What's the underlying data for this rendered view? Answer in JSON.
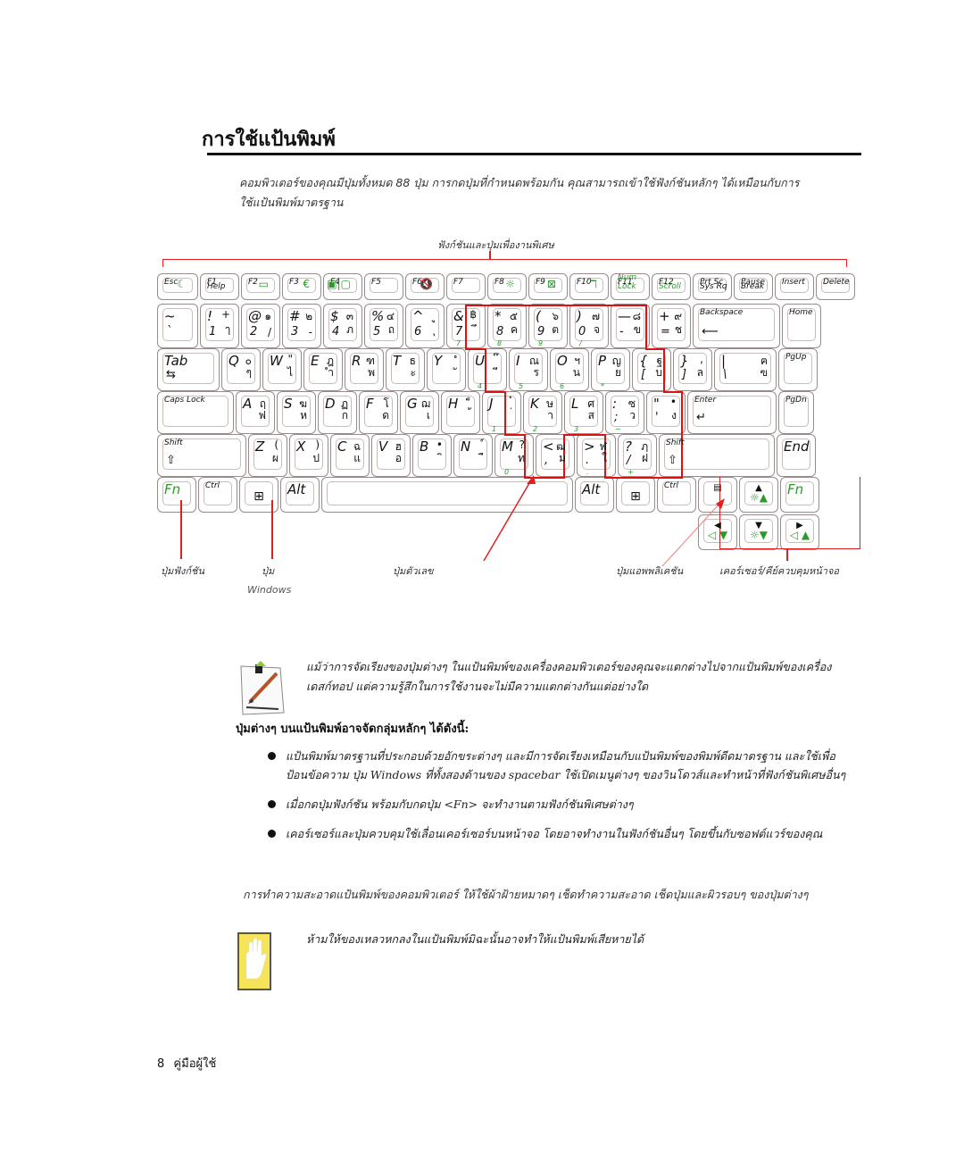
{
  "page": {
    "title": "การใช้แป้นพิมพ์",
    "intro": "คอมพิวเตอร์ของคุณมีปุ่มทั้งหมด 88 ปุ่ม การกดปุ่มที่กำหนดพร้อมกัน คุณสามารถเข้าใช้ฟังก์ชันหลักๆ ได้เหมือนกับการใช้แป้นพิมพ์มาตรฐาน"
  },
  "diagram": {
    "top_caption": "ฟังก์ชันและปุ่มเพื่องานพิเศษ",
    "callouts": {
      "fn_key": "ปุ่มฟังก์ชัน",
      "windows_key_line1": "ปุ่ม",
      "windows_key_line2": "Windows",
      "numeric_keys": "ปุ่มตัวเลข",
      "application_key": "ปุ่มแอพพลิเคชัน",
      "cursor_keys": "เคอร์เซอร์/คีย์ควบคุมหน้าจอ"
    },
    "function_row": [
      {
        "label": "Esc",
        "icon": "moon-icon",
        "glyph": "☾"
      },
      {
        "label": "F1",
        "sub": "Help"
      },
      {
        "label": "F2",
        "icon": "battery-icon",
        "glyph": "▭"
      },
      {
        "label": "F3",
        "icon": "euro-icon",
        "glyph": "€"
      },
      {
        "label": "F4",
        "icon": "display-switch-icon",
        "glyph": "▣|▢"
      },
      {
        "label": "F5"
      },
      {
        "label": "F6",
        "icon": "mute-icon",
        "glyph": "🔇"
      },
      {
        "label": "F7"
      },
      {
        "label": "F8",
        "icon": "brightness-icon",
        "glyph": "☼"
      },
      {
        "label": "F9",
        "icon": "touchpad-icon",
        "glyph": "⊠"
      },
      {
        "label": "F10",
        "icon": "wireless-icon",
        "glyph": "ℸ"
      },
      {
        "label": "F11",
        "sub": "Num Lock"
      },
      {
        "label": "F12",
        "sub": "Scroll"
      },
      {
        "label": "Prt Sc",
        "sub": "Sys Rq"
      },
      {
        "label": "Pause",
        "sub": "Break"
      },
      {
        "label": "Insert"
      },
      {
        "label": "Delete"
      }
    ],
    "number_row": [
      {
        "tl": "~",
        "bl": "`",
        "tr": "",
        "br": ""
      },
      {
        "tl": "!",
        "bl": "1",
        "tr": "+",
        "br": "ๅ"
      },
      {
        "tl": "@",
        "bl": "2",
        "tr": "๑",
        "br": "/"
      },
      {
        "tl": "#",
        "bl": "3",
        "tr": "๒",
        "br": "-"
      },
      {
        "tl": "$",
        "bl": "4",
        "tr": "๓",
        "br": "ภ"
      },
      {
        "tl": "%",
        "bl": "5",
        "tr": "๔",
        "br": "ถ"
      },
      {
        "tl": "^",
        "bl": "6",
        "tr": "ู",
        "br": "ุ"
      },
      {
        "tl": "&",
        "bl": "7",
        "tr": "฿",
        "br": "ึ",
        "num": "7"
      },
      {
        "tl": "*",
        "bl": "8",
        "tr": "๕",
        "br": "ค",
        "num": "8"
      },
      {
        "tl": "(",
        "bl": "9",
        "tr": "๖",
        "br": "ต",
        "num": "9"
      },
      {
        "tl": ")",
        "bl": "0",
        "tr": "๗",
        "br": "จ",
        "num": "/"
      },
      {
        "tl": "—",
        "bl": "-",
        "tr": "๘",
        "br": "ข"
      },
      {
        "tl": "+",
        "bl": "=",
        "tr": "๙",
        "br": "ช"
      },
      {
        "label": "Backspace",
        "glyph": "⟵"
      },
      {
        "label": "Home"
      }
    ],
    "qwerty_row": [
      {
        "label": "Tab",
        "glyph": "⇆"
      },
      {
        "tl": "Q",
        "tr": "๐",
        "br": "ๆ"
      },
      {
        "tl": "W",
        "tr": "\"",
        "br": "ไ"
      },
      {
        "tl": "E",
        "tr": "ฎ",
        "br": "ำ"
      },
      {
        "tl": "R",
        "tr": "ฑ",
        "br": "พ"
      },
      {
        "tl": "T",
        "tr": "ธ",
        "br": "ะ"
      },
      {
        "tl": "Y",
        "tr": "ํ",
        "br": "ั"
      },
      {
        "tl": "U",
        "tr": "๊",
        "br": "ี",
        "num": "4"
      },
      {
        "tl": "I",
        "tr": "ณ",
        "br": "ร",
        "num": "5"
      },
      {
        "tl": "O",
        "tr": "ฯ",
        "br": "น",
        "num": "6"
      },
      {
        "tl": "P",
        "tr": "ญ",
        "br": "ย",
        "num": "*"
      },
      {
        "tl": "{",
        "bl": "[",
        "tr": "ฐ",
        "br": "บ"
      },
      {
        "tl": "}",
        "bl": "]",
        "tr": ",",
        "br": "ล"
      },
      {
        "tl": "|",
        "bl": "\\",
        "tr": "ฅ",
        "br": "ฃ"
      },
      {
        "label": "PgUp"
      }
    ],
    "home_row": [
      {
        "label": "Caps Lock"
      },
      {
        "tl": "A",
        "tr": "ฤ",
        "br": "ฟ"
      },
      {
        "tl": "S",
        "tr": "ฆ",
        "br": "ห"
      },
      {
        "tl": "D",
        "tr": "ฏ",
        "br": "ก"
      },
      {
        "tl": "F",
        "tr": "โ",
        "br": "ด"
      },
      {
        "tl": "G",
        "tr": "ฌ",
        "br": "เ"
      },
      {
        "tl": "H",
        "tr": "็",
        "br": "้"
      },
      {
        "tl": "J",
        "tr": "๋",
        "br": "่",
        "num": "1"
      },
      {
        "tl": "K",
        "tr": "ษ",
        "br": "า",
        "num": "2"
      },
      {
        "tl": "L",
        "tr": "ศ",
        "br": "ส",
        "num": "3"
      },
      {
        "tl": ":",
        "bl": ";",
        "tr": "ซ",
        "br": "ว",
        "num": "−"
      },
      {
        "tl": "\"",
        "bl": "'",
        "tr": "•",
        "br": "ง"
      },
      {
        "label": "Enter",
        "glyph": "↵"
      },
      {
        "label": "PgDn"
      }
    ],
    "shift_row": [
      {
        "label": "Shift",
        "glyph": "⇧"
      },
      {
        "tl": "Z",
        "tr": "(",
        "br": "ผ"
      },
      {
        "tl": "X",
        "tr": ")",
        "br": "ป"
      },
      {
        "tl": "C",
        "tr": "ฉ",
        "br": "แ"
      },
      {
        "tl": "V",
        "tr": "ฮ",
        "br": "อ"
      },
      {
        "tl": "B",
        "tr": "•",
        "br": "ิ"
      },
      {
        "tl": "N",
        "tr": "์",
        "br": "ื"
      },
      {
        "tl": "M",
        "tr": "?",
        "br": "ท",
        "num": "0"
      },
      {
        "tl": "<",
        "bl": ",",
        "tr": "ฒ",
        "br": "ม"
      },
      {
        "tl": ">",
        "bl": ".",
        "tr": "ฬ",
        "br": "ใ",
        "num": "."
      },
      {
        "tl": "?",
        "bl": "/",
        "tr": "ฦ",
        "br": "ฝ",
        "num": "+"
      },
      {
        "label": "Shift",
        "glyph": "⇧"
      },
      {
        "label": "End"
      }
    ],
    "bottom_row": [
      {
        "label": "Fn"
      },
      {
        "label": "Ctrl"
      },
      {
        "glyph": "⊞"
      },
      {
        "label": "Alt"
      },
      {
        "label": ""
      },
      {
        "label": "Alt"
      },
      {
        "glyph": "⊞"
      },
      {
        "label": "Ctrl"
      },
      {
        "glyph": "▤"
      },
      {
        "glyph": "▲",
        "sub": "☼▲"
      },
      {
        "label": "Fn"
      }
    ],
    "arrow_row": [
      {
        "glyph": "◀",
        "sub": "◁ ▼"
      },
      {
        "glyph": "▼",
        "sub": "☼▼"
      },
      {
        "glyph": "▶",
        "sub": "◁ ▲"
      }
    ]
  },
  "note": {
    "text": "แม้ว่าการจัดเรียงของปุ่มต่างๆ ในแป้นพิมพ์ของเครื่องคอมพิวเตอร์ของคุณจะแตกต่างไปจากแป้นพิมพ์ของเครื่องเดสก์ทอป แต่ความรู้สึกในการใช้งานจะไม่มีความแตกต่างกันแต่อย่างใด"
  },
  "section": {
    "heading": "ปุ่มต่างๆ บนแป้นพิมพ์อาจจัดกลุ่มหลักๆ ได้ดังนี้:",
    "bullets": [
      "แป้นพิมพ์มาตรฐานที่ประกอบด้วยอักขระต่างๆ และมีการจัดเรียงเหมือนกับแป้นพิมพ์ของพิมพ์ดีดมาตรฐาน และใช้เพื่อป้อนข้อความ ปุ่ม Windows ที่ทั้งสองด้านของ spacebar ใช้เปิดเมนูต่างๆ ของวินโดวส์และทำหน้าที่ฟังก์ชันพิเศษอื่นๆ",
      "เมื่อกดปุ่มฟังก์ชัน พร้อมกับกดปุ่ม <Fn> จะทำงานตามฟังก์ชันพิเศษต่างๆ",
      "เคอร์เซอร์และปุ่มควบคุมใช้เลื่อนเคอร์เซอร์บนหน้าจอ โดยอาจทำงานในฟังก์ชันอื่นๆ โดยขึ้นกับซอฟต์แวร์ของคุณ"
    ],
    "cleaning": "การทำความสะอาดแป้นพิมพ์ของคอมพิวเตอร์ ให้ใช้ผ้าฝ้ายหมาดๆ เช็ดทำความสะอาด เช็ดปุ่มและผิวรอบๆ ของปุ่มต่างๆ"
  },
  "warning": {
    "text": "ห้ามให้ของเหลวหกลงในแป้นพิมพ์มิฉะนั้นอาจทำให้แป้นพิมพ์เสียหายได้"
  },
  "footer": {
    "page_number": "8",
    "label": "คู่มือผู้ใช้"
  },
  "colors": {
    "highlight_red": "#e01010",
    "fn_green": "#2a9a2a",
    "warning_yellow": "#f5e35a"
  }
}
